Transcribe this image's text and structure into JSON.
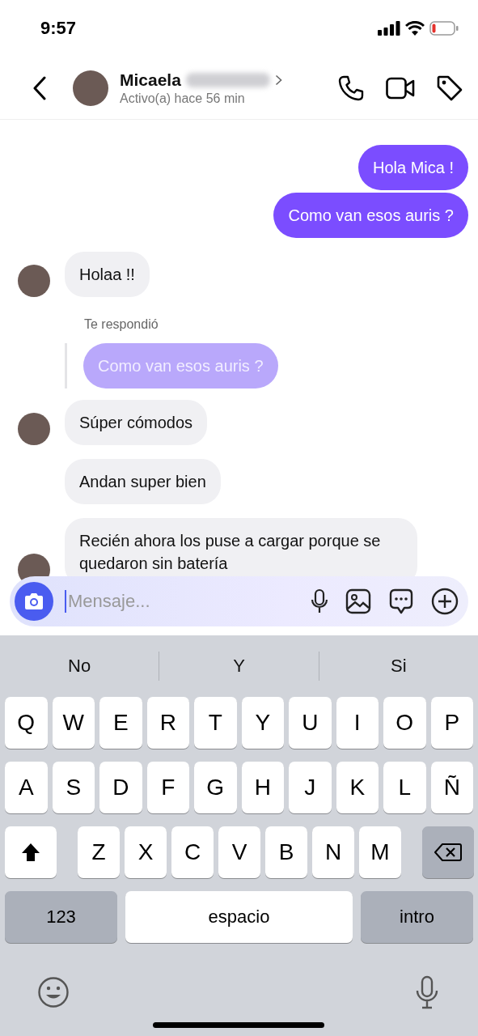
{
  "status_bar": {
    "time": "9:57"
  },
  "header": {
    "name": "Micaela",
    "status": "Activo(a) hace 56 min"
  },
  "messages": [
    {
      "kind": "sent",
      "text": "Hola Mica !"
    },
    {
      "kind": "sent",
      "text": "Como van esos auris ?"
    },
    {
      "kind": "received",
      "text": "Holaa !!",
      "avatar": true
    },
    {
      "kind": "reply_label",
      "text": "Te respondió"
    },
    {
      "kind": "quoted",
      "text": "Como van esos auris ?"
    },
    {
      "kind": "received",
      "text": "Súper cómodos",
      "avatar": true
    },
    {
      "kind": "received",
      "text": "Andan super bien",
      "avatar": false
    },
    {
      "kind": "received",
      "text": "Recién ahora los puse a cargar porque se quedaron sin batería",
      "avatar": true
    }
  ],
  "composer": {
    "placeholder": "Mensaje..."
  },
  "keyboard": {
    "suggestions": [
      "No",
      "Y",
      "Si"
    ],
    "rows": [
      [
        {
          "kind": "letter",
          "label": "Q"
        },
        {
          "kind": "letter",
          "label": "W"
        },
        {
          "kind": "letter",
          "label": "E"
        },
        {
          "kind": "letter",
          "label": "R"
        },
        {
          "kind": "letter",
          "label": "T"
        },
        {
          "kind": "letter",
          "label": "Y"
        },
        {
          "kind": "letter",
          "label": "U"
        },
        {
          "kind": "letter",
          "label": "I"
        },
        {
          "kind": "letter",
          "label": "O"
        },
        {
          "kind": "letter",
          "label": "P"
        }
      ],
      [
        {
          "kind": "letter",
          "label": "A"
        },
        {
          "kind": "letter",
          "label": "S"
        },
        {
          "kind": "letter",
          "label": "D"
        },
        {
          "kind": "letter",
          "label": "F"
        },
        {
          "kind": "letter",
          "label": "G"
        },
        {
          "kind": "letter",
          "label": "H"
        },
        {
          "kind": "letter",
          "label": "J"
        },
        {
          "kind": "letter",
          "label": "K"
        },
        {
          "kind": "letter",
          "label": "L"
        },
        {
          "kind": "letter",
          "label": "Ñ"
        }
      ],
      [
        {
          "kind": "shift"
        },
        {
          "kind": "letter",
          "label": "Z"
        },
        {
          "kind": "letter",
          "label": "X"
        },
        {
          "kind": "letter",
          "label": "C"
        },
        {
          "kind": "letter",
          "label": "V"
        },
        {
          "kind": "letter",
          "label": "B"
        },
        {
          "kind": "letter",
          "label": "N"
        },
        {
          "kind": "letter",
          "label": "M"
        },
        {
          "kind": "backspace"
        }
      ]
    ],
    "bottom_keys": [
      {
        "kind": "function",
        "label": "123"
      },
      {
        "kind": "space",
        "label": "espacio"
      },
      {
        "kind": "function",
        "label": "intro"
      }
    ]
  }
}
